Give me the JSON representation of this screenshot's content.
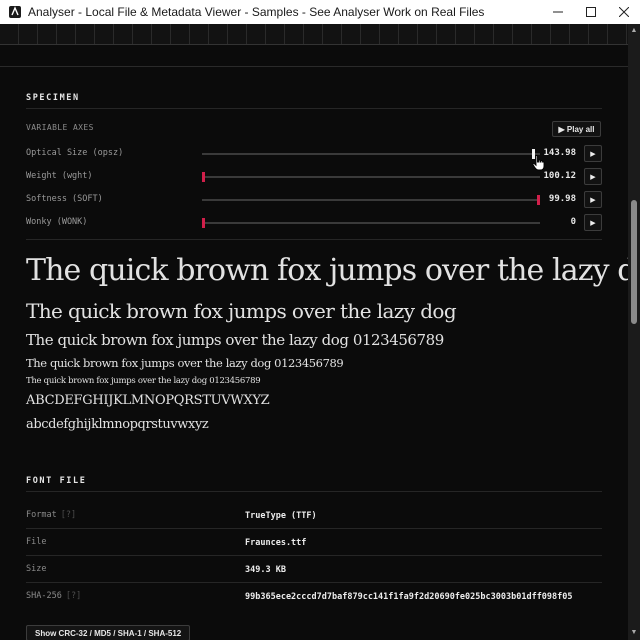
{
  "window": {
    "title": "Analyser - Local File & Metadata Viewer - Samples - See Analyser Work on Real Files",
    "minimize_icon": "minimize-icon",
    "maximize_icon": "maximize-icon",
    "close_icon": "close-icon"
  },
  "specimen": {
    "section_title": "SPECIMEN",
    "variable_axes_label": "VARIABLE AXES",
    "play_all_label": "▶ Play all",
    "axes": [
      {
        "name": "Optical Size (opsz)",
        "value": "143.98",
        "level": 0.985,
        "thumb_color": "#f2f2f2",
        "play": "▶"
      },
      {
        "name": "Weight (wght)",
        "value": "100.12",
        "level": 0.0,
        "thumb_color": "#d11f4a",
        "play": "▶"
      },
      {
        "name": "Softness (SOFT)",
        "value": "99.98",
        "level": 1.0,
        "thumb_color": "#d11f4a",
        "play": "▶"
      },
      {
        "name": "Wonky (WONK)",
        "value": "0",
        "level": 0.0,
        "thumb_color": "#d11f4a",
        "play": "▶"
      }
    ],
    "lines": [
      "The quick brown fox jumps over the lazy dog",
      "The quick brown fox jumps over the lazy dog",
      "The quick brown fox jumps over the lazy dog 0123456789",
      "The quick brown fox jumps over the lazy dog 0123456789",
      "The quick brown fox jumps over the lazy dog 0123456789",
      "ABCDEFGHIJKLMNOPQRSTUVWXYZ",
      "abcdefghijklmnopqrstuvwxyz"
    ]
  },
  "font_file": {
    "section_title": "FONT FILE",
    "rows": [
      {
        "key": "Format",
        "help": "[?]",
        "value": "TrueType (TTF)"
      },
      {
        "key": "File",
        "help": "",
        "value": "Fraunces.ttf"
      },
      {
        "key": "Size",
        "help": "",
        "value": "349.3 KB"
      },
      {
        "key": "SHA-256",
        "help": "[?]",
        "value": "99b365ece2cccd7d7baf879cc141f1fa9f2d20690fe025bc3003b01dff098f05"
      }
    ],
    "show_hashes_label": "Show CRC-32 / MD5 / SHA-1 / SHA-512"
  },
  "colors": {
    "accent": "#d11f4a",
    "background": "#0b0b0b"
  }
}
